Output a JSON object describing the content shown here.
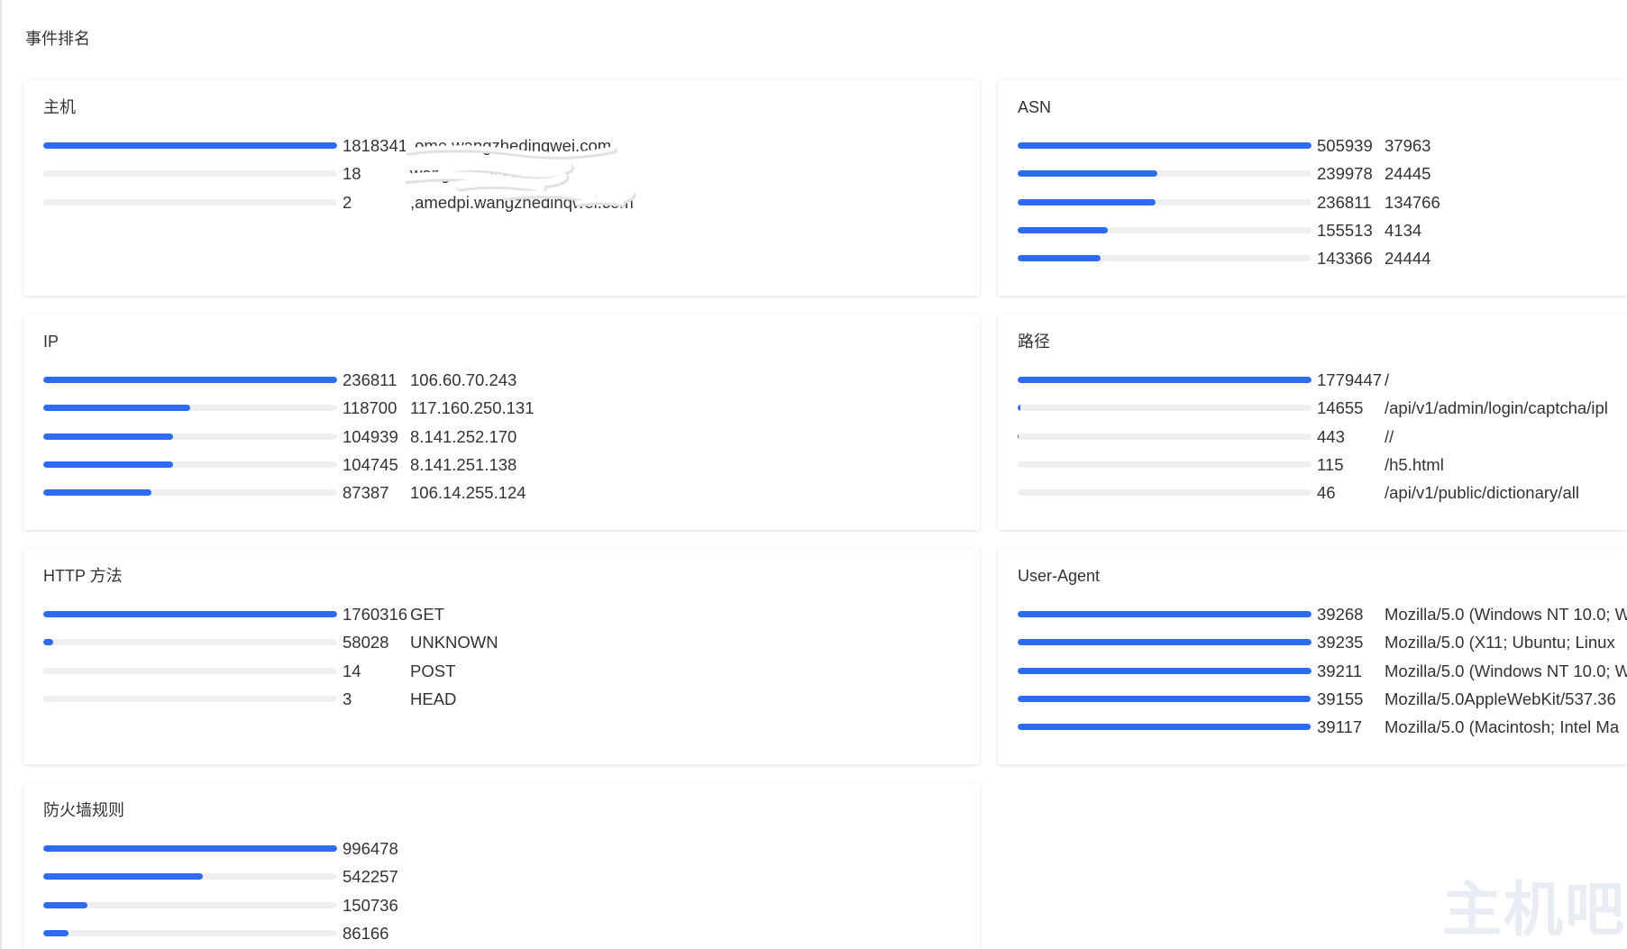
{
  "page_title": "事件排名",
  "colors": {
    "bar_fill": "#2d6cf2",
    "bar_track": "#efefef",
    "text": "#333333"
  },
  "watermark": "主机吧",
  "cards": [
    {
      "title": "主机",
      "rows": [
        {
          "count": 1818341,
          "label": ",ome.wangzhedinqwei.com"
        },
        {
          "count": 18,
          "label": "wangzh  di  y i.com"
        },
        {
          "count": 2,
          "label": ",amedpi.wangzhedinqwei.com"
        }
      ]
    },
    {
      "title": "ASN",
      "rows": [
        {
          "count": 505939,
          "label": "37963"
        },
        {
          "count": 239978,
          "label": "24445"
        },
        {
          "count": 236811,
          "label": "134766"
        },
        {
          "count": 155513,
          "label": "4134"
        },
        {
          "count": 143366,
          "label": "24444"
        }
      ]
    },
    {
      "title": "IP",
      "rows": [
        {
          "count": 236811,
          "label": "106.60.70.243"
        },
        {
          "count": 118700,
          "label": "117.160.250.131"
        },
        {
          "count": 104939,
          "label": "8.141.252.170"
        },
        {
          "count": 104745,
          "label": "8.141.251.138"
        },
        {
          "count": 87387,
          "label": "106.14.255.124"
        }
      ]
    },
    {
      "title": "路径",
      "rows": [
        {
          "count": 1779447,
          "label": "/"
        },
        {
          "count": 14655,
          "label": "/api/v1/admin/login/captcha/ipl"
        },
        {
          "count": 443,
          "label": "//"
        },
        {
          "count": 115,
          "label": "/h5.html"
        },
        {
          "count": 46,
          "label": "/api/v1/public/dictionary/all"
        }
      ]
    },
    {
      "title": "HTTP 方法",
      "rows": [
        {
          "count": 1760316,
          "label": "GET"
        },
        {
          "count": 58028,
          "label": "UNKNOWN"
        },
        {
          "count": 14,
          "label": "POST"
        },
        {
          "count": 3,
          "label": "HEAD"
        }
      ]
    },
    {
      "title": "User-Agent",
      "rows": [
        {
          "count": 39268,
          "label": "Mozilla/5.0 (Windows NT 10.0; W"
        },
        {
          "count": 39235,
          "label": "Mozilla/5.0 (X11; Ubuntu; Linux"
        },
        {
          "count": 39211,
          "label": "Mozilla/5.0 (Windows NT 10.0; W"
        },
        {
          "count": 39155,
          "label": "Mozilla/5.0AppleWebKit/537.36"
        },
        {
          "count": 39117,
          "label": "Mozilla/5.0 (Macintosh; Intel Ma"
        }
      ]
    },
    {
      "title": "防火墙规则",
      "rows": [
        {
          "count": 996478
        },
        {
          "count": 542257
        },
        {
          "count": 150736
        },
        {
          "count": 86166
        }
      ]
    }
  ]
}
